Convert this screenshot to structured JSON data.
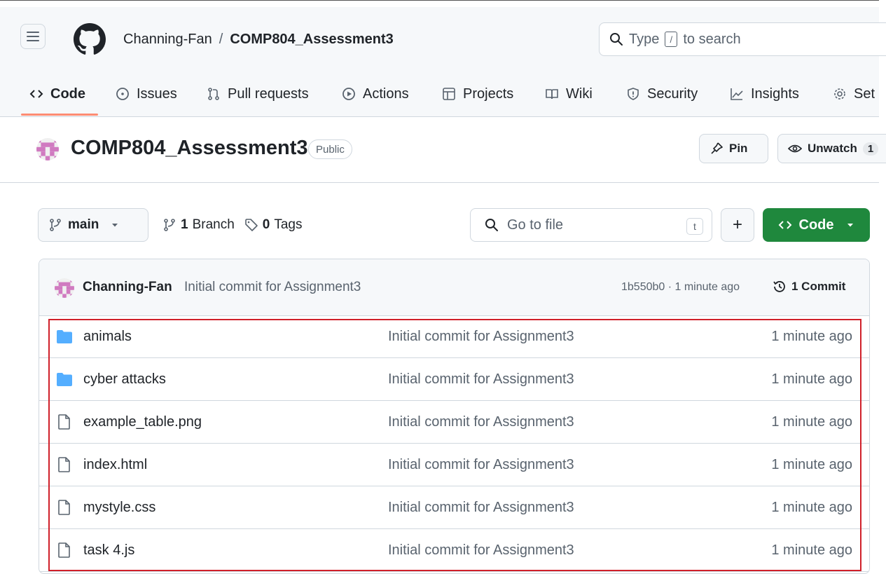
{
  "header": {
    "owner": "Channing-Fan",
    "separator": "/",
    "repo": "COMP804_Assessment3",
    "search_label": "Type",
    "search_key": "/",
    "search_suffix": "to search"
  },
  "tabs": [
    {
      "label": "Code",
      "icon": "code-icon",
      "active": true
    },
    {
      "label": "Issues",
      "icon": "issue-icon"
    },
    {
      "label": "Pull requests",
      "icon": "pull-request-icon"
    },
    {
      "label": "Actions",
      "icon": "play-icon"
    },
    {
      "label": "Projects",
      "icon": "table-icon"
    },
    {
      "label": "Wiki",
      "icon": "book-icon"
    },
    {
      "label": "Security",
      "icon": "shield-icon"
    },
    {
      "label": "Insights",
      "icon": "graph-icon"
    },
    {
      "label": "Set",
      "icon": "gear-icon"
    }
  ],
  "repo_header": {
    "title": "COMP804_Assessment3",
    "visibility": "Public",
    "pin_label": "Pin",
    "unwatch_label": "Unwatch",
    "watch_count": "1"
  },
  "toolbar": {
    "branch": "main",
    "branch_count": "1",
    "branch_label": "Branch",
    "tag_count": "0",
    "tag_label": "Tags",
    "goto_placeholder": "Go to file",
    "goto_key": "t",
    "plus_label": "+",
    "code_label": "Code"
  },
  "commit": {
    "author": "Channing-Fan",
    "message": "Initial commit for Assignment3",
    "meta": "1b550b0 · 1 minute ago",
    "count_label": "1 Commit"
  },
  "files": [
    {
      "name": "animals",
      "type": "folder",
      "message": "Initial commit for Assignment3",
      "time": "1 minute ago"
    },
    {
      "name": "cyber attacks",
      "type": "folder",
      "message": "Initial commit for Assignment3",
      "time": "1 minute ago"
    },
    {
      "name": "example_table.png",
      "type": "file",
      "message": "Initial commit for Assignment3",
      "time": "1 minute ago"
    },
    {
      "name": "index.html",
      "type": "file",
      "message": "Initial commit for Assignment3",
      "time": "1 minute ago"
    },
    {
      "name": "mystyle.css",
      "type": "file",
      "message": "Initial commit for Assignment3",
      "time": "1 minute ago"
    },
    {
      "name": "task 4.js",
      "type": "file",
      "message": "Initial commit for Assignment3",
      "time": "1 minute ago"
    }
  ],
  "colors": {
    "accent_green": "#1f883d",
    "tab_underline": "#fd8c73",
    "folder_blue": "#54aeff",
    "highlight_red": "#d0202a"
  }
}
